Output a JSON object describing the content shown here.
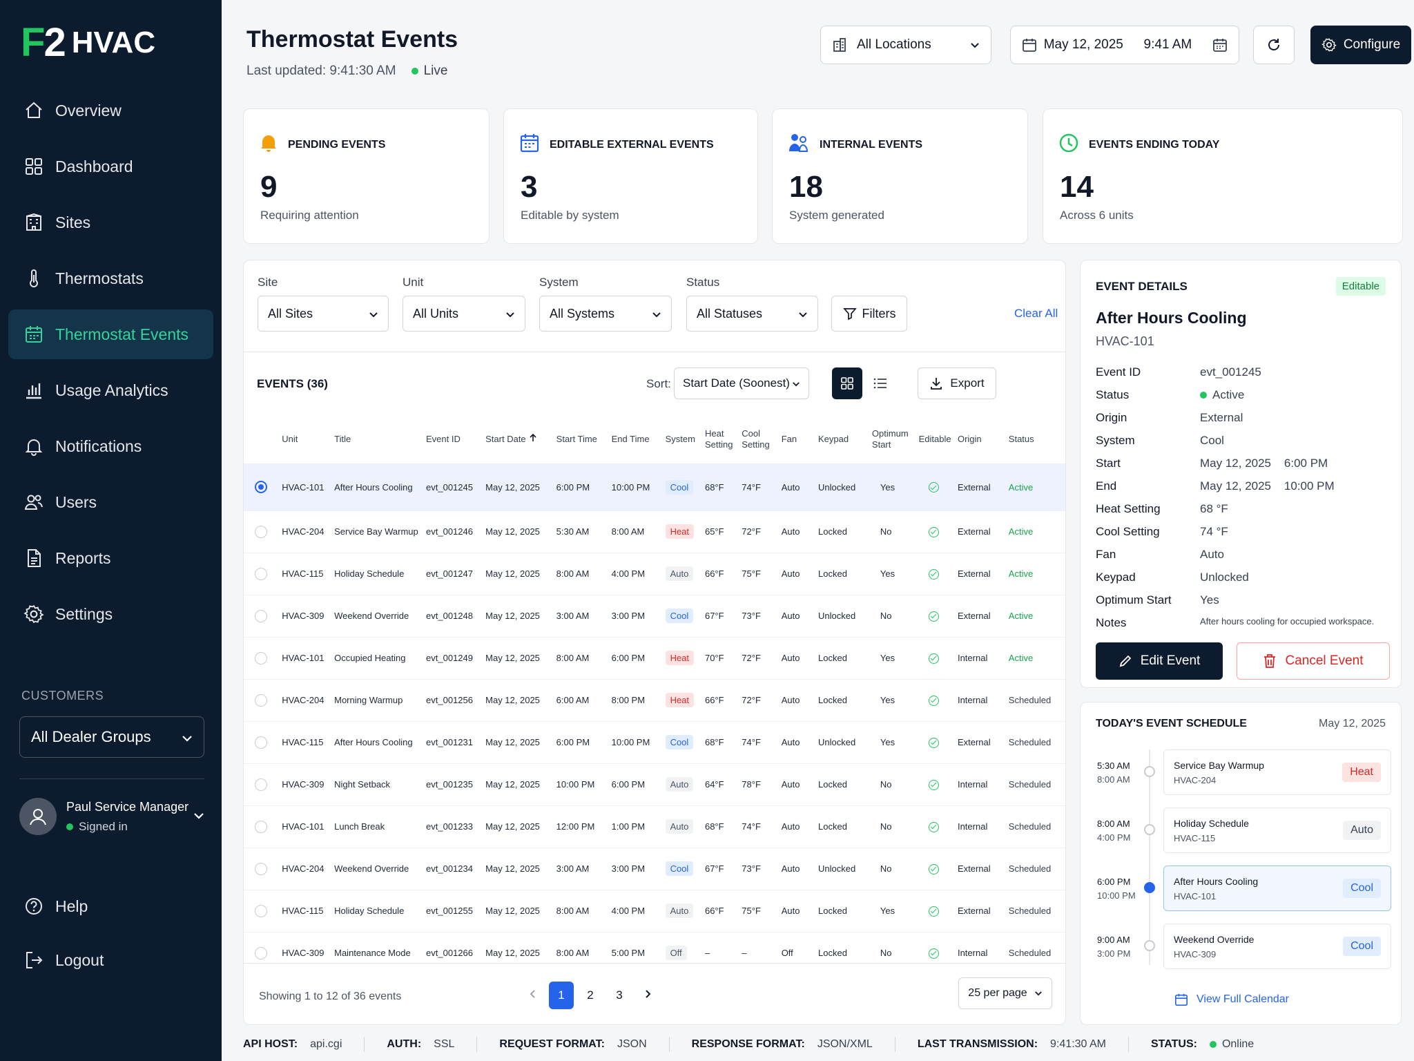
{
  "brand": {
    "mark_f": "F",
    "mark_2": "2",
    "name": "HVAC"
  },
  "nav": [
    {
      "label": "Overview",
      "icon": "home-icon"
    },
    {
      "label": "Dashboard",
      "icon": "grid-icon"
    },
    {
      "label": "Sites",
      "icon": "building-icon"
    },
    {
      "label": "Thermostats",
      "icon": "thermometer-icon"
    },
    {
      "label": "Thermostat Events",
      "icon": "calendar-icon",
      "active": true
    },
    {
      "label": "Usage Analytics",
      "icon": "bar-chart-icon"
    },
    {
      "label": "Notifications",
      "icon": "bell-icon"
    },
    {
      "label": "Users",
      "icon": "users-icon"
    },
    {
      "label": "Reports",
      "icon": "document-icon"
    },
    {
      "label": "Settings",
      "icon": "gear-icon"
    }
  ],
  "customers": {
    "label": "CUSTOMERS",
    "dealer_group": "All Dealer Groups"
  },
  "user": {
    "name": "Paul Service Manager",
    "status": "Signed in"
  },
  "bottom_nav": [
    {
      "label": "Help",
      "icon": "help-icon"
    },
    {
      "label": "Logout",
      "icon": "logout-icon"
    }
  ],
  "header": {
    "title": "Thermostat Events",
    "last_updated": "Last updated: 9:41:30 AM",
    "live": "Live",
    "location": "All Locations",
    "date": "May 12, 2025",
    "time": "9:41 AM",
    "configure": "Configure"
  },
  "cards": [
    {
      "title": "PENDING EVENTS",
      "value": "9",
      "sub": "Requiring attention",
      "icon": "bell-icon",
      "color": "#f59e0b"
    },
    {
      "title": "EDITABLE EXTERNAL EVENTS",
      "value": "3",
      "sub": "Editable by system",
      "icon": "calendar-icon",
      "color": "#2563eb"
    },
    {
      "title": "INTERNAL EVENTS",
      "value": "18",
      "sub": "System generated",
      "icon": "users-icon",
      "color": "#2563eb"
    },
    {
      "title": "EVENTS ENDING TODAY",
      "value": "14",
      "sub": "Across 6 units",
      "icon": "clock-icon",
      "color": "#22c55e"
    }
  ],
  "filters": {
    "site": {
      "label": "Site",
      "value": "All Sites"
    },
    "unit": {
      "label": "Unit",
      "value": "All Units"
    },
    "system": {
      "label": "System",
      "value": "All Systems"
    },
    "status": {
      "label": "Status",
      "value": "All Statuses"
    },
    "filters_btn": "Filters",
    "clear_all": "Clear All"
  },
  "events": {
    "title": "EVENTS (36)",
    "sort_label": "Sort:",
    "sort_value": "Start Date (Soonest)",
    "export": "Export",
    "columns": [
      "Unit",
      "Title",
      "Event ID",
      "Start Date",
      "Start Time",
      "End Time",
      "System",
      "Heat Setting",
      "Cool Setting",
      "Fan",
      "Keypad",
      "Optimum Start",
      "Editable",
      "Origin",
      "Status"
    ],
    "rows": [
      {
        "unit": "HVAC-101",
        "title": "After Hours Cooling",
        "id": "evt_001245",
        "date": "May 12, 2025",
        "start": "6:00 PM",
        "end": "10:00 PM",
        "system": "Cool",
        "heat": "68°F",
        "cool": "74°F",
        "fan": "Auto",
        "keypad": "Unlocked",
        "opt": "Yes",
        "origin": "External",
        "status": "Active",
        "selected": true
      },
      {
        "unit": "HVAC-204",
        "title": "Service Bay Warmup",
        "id": "evt_001246",
        "date": "May 12, 2025",
        "start": "5:30 AM",
        "end": "8:00 AM",
        "system": "Heat",
        "heat": "65°F",
        "cool": "72°F",
        "fan": "Auto",
        "keypad": "Locked",
        "opt": "No",
        "origin": "External",
        "status": "Active"
      },
      {
        "unit": "HVAC-115",
        "title": "Holiday Schedule",
        "id": "evt_001247",
        "date": "May 12, 2025",
        "start": "8:00 AM",
        "end": "4:00 PM",
        "system": "Auto",
        "heat": "66°F",
        "cool": "75°F",
        "fan": "Auto",
        "keypad": "Locked",
        "opt": "Yes",
        "origin": "External",
        "status": "Active"
      },
      {
        "unit": "HVAC-309",
        "title": "Weekend Override",
        "id": "evt_001248",
        "date": "May 12, 2025",
        "start": "3:00 AM",
        "end": "3:00 PM",
        "system": "Cool",
        "heat": "67°F",
        "cool": "73°F",
        "fan": "Auto",
        "keypad": "Unlocked",
        "opt": "No",
        "origin": "External",
        "status": "Active"
      },
      {
        "unit": "HVAC-101",
        "title": "Occupied Heating",
        "id": "evt_001249",
        "date": "May 12, 2025",
        "start": "8:00 AM",
        "end": "6:00 PM",
        "system": "Heat",
        "heat": "70°F",
        "cool": "72°F",
        "fan": "Auto",
        "keypad": "Locked",
        "opt": "Yes",
        "origin": "Internal",
        "status": "Active"
      },
      {
        "unit": "HVAC-204",
        "title": "Morning Warmup",
        "id": "evt_001256",
        "date": "May 12, 2025",
        "start": "6:00 AM",
        "end": "8:00 PM",
        "system": "Heat",
        "heat": "66°F",
        "cool": "72°F",
        "fan": "Auto",
        "keypad": "Locked",
        "opt": "Yes",
        "origin": "Internal",
        "status": "Scheduled"
      },
      {
        "unit": "HVAC-115",
        "title": "After Hours Cooling",
        "id": "evt_001231",
        "date": "May 12, 2025",
        "start": "6:00 PM",
        "end": "10:00 PM",
        "system": "Cool",
        "heat": "68°F",
        "cool": "74°F",
        "fan": "Auto",
        "keypad": "Unlocked",
        "opt": "Yes",
        "origin": "External",
        "status": "Scheduled"
      },
      {
        "unit": "HVAC-309",
        "title": "Night Setback",
        "id": "evt_001235",
        "date": "May 12, 2025",
        "start": "10:00 PM",
        "end": "6:00 PM",
        "system": "Auto",
        "heat": "64°F",
        "cool": "78°F",
        "fan": "Auto",
        "keypad": "Locked",
        "opt": "No",
        "origin": "Internal",
        "status": "Scheduled"
      },
      {
        "unit": "HVAC-101",
        "title": "Lunch Break",
        "id": "evt_001233",
        "date": "May 12, 2025",
        "start": "12:00 PM",
        "end": "1:00 PM",
        "system": "Auto",
        "heat": "68°F",
        "cool": "74°F",
        "fan": "Auto",
        "keypad": "Locked",
        "opt": "No",
        "origin": "Internal",
        "status": "Scheduled"
      },
      {
        "unit": "HVAC-204",
        "title": "Weekend Override",
        "id": "evt_001234",
        "date": "May 12, 2025",
        "start": "3:00 AM",
        "end": "3:00 PM",
        "system": "Cool",
        "heat": "67°F",
        "cool": "73°F",
        "fan": "Auto",
        "keypad": "Unlocked",
        "opt": "No",
        "origin": "External",
        "status": "Scheduled"
      },
      {
        "unit": "HVAC-115",
        "title": "Holiday Schedule",
        "id": "evt_001255",
        "date": "May 12, 2025",
        "start": "8:00 AM",
        "end": "4:00 PM",
        "system": "Auto",
        "heat": "66°F",
        "cool": "75°F",
        "fan": "Auto",
        "keypad": "Locked",
        "opt": "Yes",
        "origin": "External",
        "status": "Scheduled"
      },
      {
        "unit": "HVAC-309",
        "title": "Maintenance Mode",
        "id": "evt_001266",
        "date": "May 12, 2025",
        "start": "8:00 AM",
        "end": "5:00 PM",
        "system": "Off",
        "heat": "–",
        "cool": "–",
        "fan": "Off",
        "keypad": "Locked",
        "opt": "No",
        "origin": "Internal",
        "status": "Scheduled"
      }
    ],
    "showing": "Showing 1 to 12 of 36 events",
    "pages": [
      "1",
      "2",
      "3"
    ],
    "per_page": "25 per page"
  },
  "detail": {
    "header": "EVENT DETAILS",
    "badge": "Editable",
    "title": "After Hours Cooling",
    "unit": "HVAC-101",
    "fields": [
      {
        "k": "Event ID",
        "v": "evt_001245"
      },
      {
        "k": "Status",
        "v": "Active"
      },
      {
        "k": "Origin",
        "v": "External"
      },
      {
        "k": "System",
        "v": "Cool"
      },
      {
        "k": "Start",
        "v": "May 12, 2025    6:00 PM"
      },
      {
        "k": "End",
        "v": "May 12, 2025    10:00 PM"
      },
      {
        "k": "Heat Setting",
        "v": "68 °F"
      },
      {
        "k": "Cool Setting",
        "v": "74 °F"
      },
      {
        "k": "Fan",
        "v": "Auto"
      },
      {
        "k": "Keypad",
        "v": "Unlocked"
      },
      {
        "k": "Optimum Start",
        "v": "Yes"
      },
      {
        "k": "Notes",
        "v": "After hours cooling for occupied workspace."
      }
    ],
    "edit": "Edit Event",
    "cancel": "Cancel Event"
  },
  "schedule": {
    "header": "TODAY'S EVENT SCHEDULE",
    "date": "May 12, 2025",
    "items": [
      {
        "t1": "5:30 AM",
        "t2": "8:00 AM",
        "name": "Service Bay Warmup",
        "unit": "HVAC-204",
        "system": "Heat"
      },
      {
        "t1": "8:00 AM",
        "t2": "4:00 PM",
        "name": "Holiday Schedule",
        "unit": "HVAC-115",
        "system": "Auto"
      },
      {
        "t1": "6:00 PM",
        "t2": "10:00 PM",
        "name": "After Hours Cooling",
        "unit": "HVAC-101",
        "system": "Cool",
        "active": true
      },
      {
        "t1": "9:00 AM",
        "t2": "3:00 PM",
        "name": "Weekend Override",
        "unit": "HVAC-309",
        "system": "Cool"
      }
    ],
    "calendar_link": "View Full Calendar"
  },
  "footer": [
    {
      "k": "API HOST:",
      "v": "api.cgi"
    },
    {
      "k": "AUTH:",
      "v": "SSL"
    },
    {
      "k": "REQUEST FORMAT:",
      "v": "JSON"
    },
    {
      "k": "RESPONSE FORMAT:",
      "v": "JSON/XML"
    },
    {
      "k": "LAST TRANSMISSION:",
      "v": "9:41:30 AM"
    },
    {
      "k": "STATUS:",
      "v": "Online"
    }
  ]
}
